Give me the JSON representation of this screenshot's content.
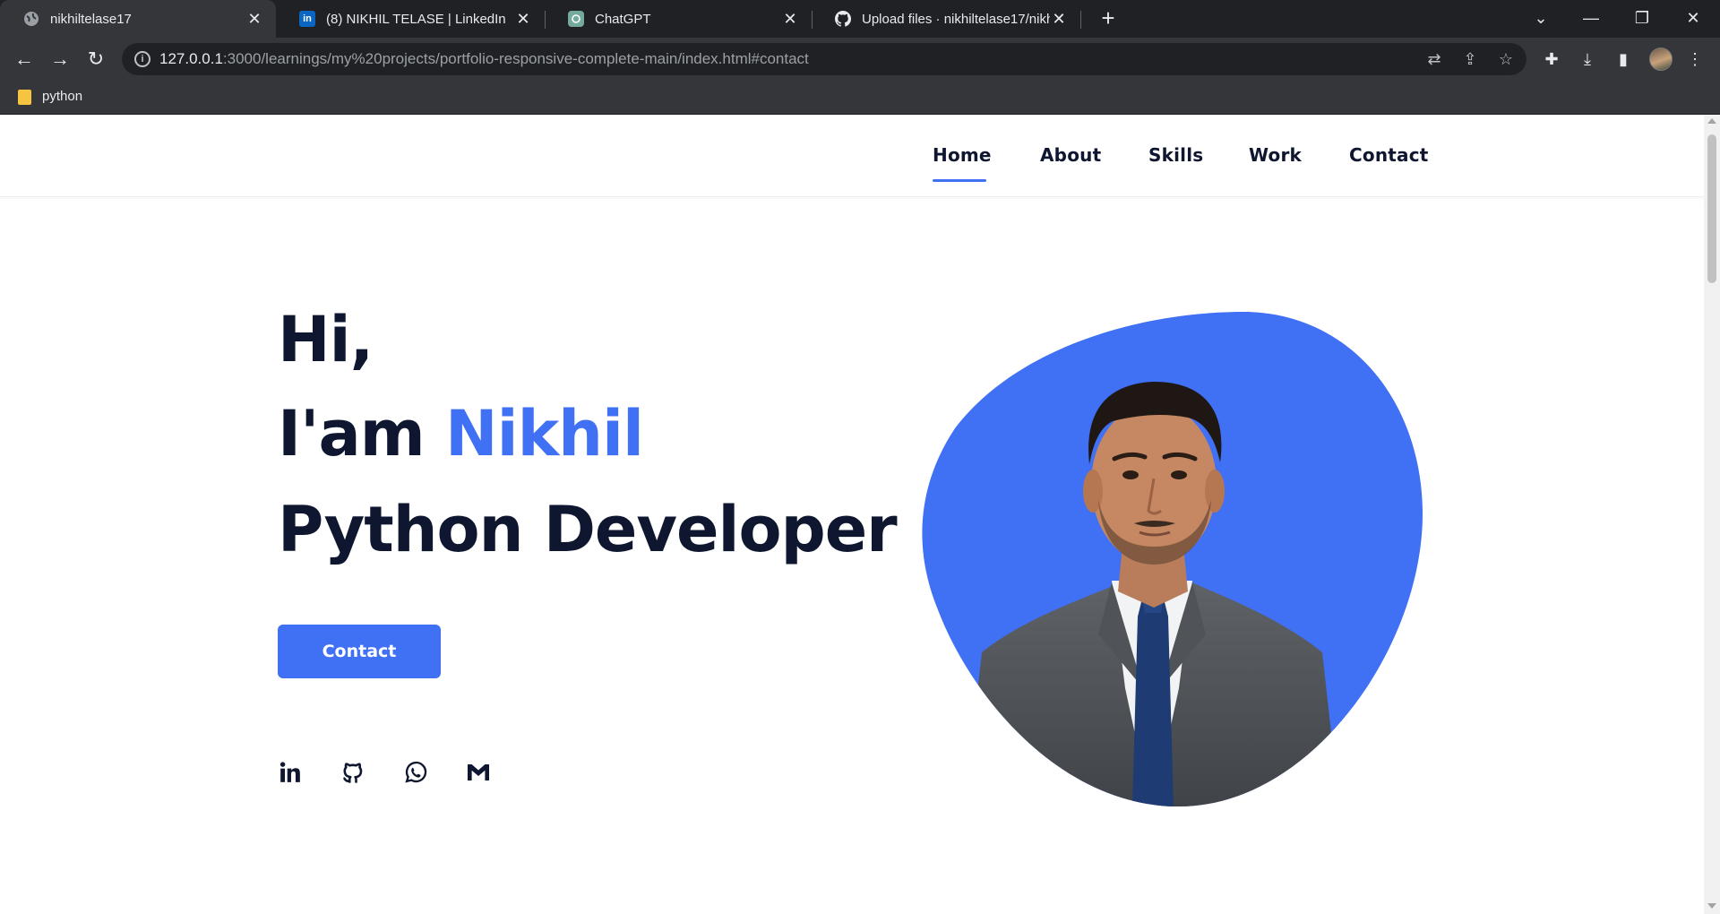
{
  "browser": {
    "tabs": [
      {
        "title": "nikhiltelase17",
        "icon": "globe-icon",
        "active": true
      },
      {
        "title": "(8) NIKHIL TELASE | LinkedIn",
        "icon": "linkedin-icon",
        "active": false
      },
      {
        "title": "ChatGPT",
        "icon": "chatgpt-icon",
        "active": false
      },
      {
        "title": "Upload files · nikhiltelase17/nikhi",
        "icon": "github-icon",
        "active": false
      }
    ],
    "url_host": "127.0.0.1",
    "url_rest": ":3000/learnings/my%20projects/portfolio-responsive-complete-main/index.html#contact",
    "bookmarks": [
      {
        "label": "python",
        "icon": "folder-icon"
      }
    ]
  },
  "site": {
    "nav": [
      "Home",
      "About",
      "Skills",
      "Work",
      "Contact"
    ],
    "active_nav": "Home",
    "hero": {
      "line1": "Hi,",
      "line2_prefix": "I'am ",
      "name": "Nikhil",
      "line3": "Python Developer",
      "button": "Contact"
    },
    "socials": [
      "linkedin-icon",
      "github-icon",
      "whatsapp-icon",
      "gmail-icon"
    ],
    "colors": {
      "accent": "#4070f4",
      "text": "#0e1630"
    }
  }
}
